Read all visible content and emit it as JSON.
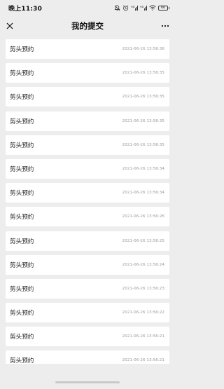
{
  "status_bar": {
    "time": "晚上11:30",
    "battery": "66"
  },
  "nav": {
    "title": "我的提交"
  },
  "submissions": [
    {
      "title": "剪头预约",
      "time": "2021-06-26 13:56:36"
    },
    {
      "title": "剪头预约",
      "time": "2021-06-26 13:56:35"
    },
    {
      "title": "剪头预约",
      "time": "2021-06-26 13:56:35"
    },
    {
      "title": "剪头预约",
      "time": "2021-06-26 13:56:35"
    },
    {
      "title": "剪头预约",
      "time": "2021-06-26 13:56:35"
    },
    {
      "title": "剪头预约",
      "time": "2021-06-26 13:56:34"
    },
    {
      "title": "剪头预约",
      "time": "2021-06-26 13:56:34"
    },
    {
      "title": "剪头预约",
      "time": "2021-06-26 13:56:26"
    },
    {
      "title": "剪头预约",
      "time": "2021-06-26 13:56:25"
    },
    {
      "title": "剪头预约",
      "time": "2021-06-26 13:56:24"
    },
    {
      "title": "剪头预约",
      "time": "2021-06-26 13:56:23"
    },
    {
      "title": "剪头预约",
      "time": "2021-06-26 13:56:22"
    },
    {
      "title": "剪头预约",
      "time": "2021-06-26 13:56:21"
    },
    {
      "title": "剪头预约",
      "time": "2021-06-26 13:56:21"
    }
  ]
}
